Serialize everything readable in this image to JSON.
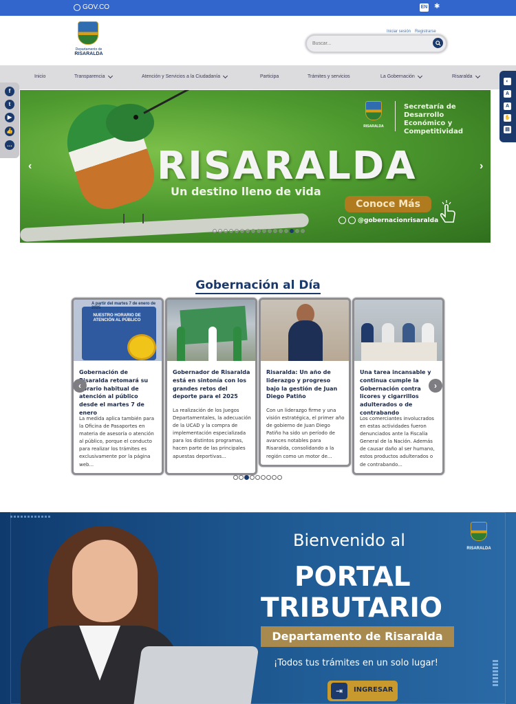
{
  "govbar": {
    "logo_text": "GOV.CO",
    "lang": "EN",
    "accessibility_icon": "accessibility-icon"
  },
  "header": {
    "logo_line1": "Departamento de",
    "logo_line2": "RISARALDA",
    "login": "Iniciar sesión",
    "register": "Registrarse",
    "search_placeholder": "Buscar..."
  },
  "nav": {
    "items": [
      {
        "label": "Inicio",
        "dropdown": false
      },
      {
        "label": "Transparencia",
        "dropdown": true
      },
      {
        "label": "Atención y Servicios a la Ciudadanía",
        "dropdown": true
      },
      {
        "label": "Participa",
        "dropdown": false
      },
      {
        "label": "Trámites y servicios",
        "dropdown": false
      },
      {
        "label": "La Gobernación",
        "dropdown": true
      },
      {
        "label": "Risaralda",
        "dropdown": true
      }
    ]
  },
  "social": [
    "facebook-icon",
    "twitter-icon",
    "youtube-icon",
    "like-icon",
    "chat-icon"
  ],
  "hero": {
    "title": "RISARALDA",
    "subtitle": "Un destino lleno de vida",
    "cta": "Conoce Más",
    "social_handle": "@gobernacionrisaralda",
    "secretaria": "Secretaría de Desarrollo Económico y Competitividad",
    "secretaria_logo": "RISARALDA",
    "slides_count": 17,
    "active_slide": 14
  },
  "section": {
    "title": "Gobernación al Día"
  },
  "news": [
    {
      "poster_top": "A partir del martes 7 de enero de 2025",
      "poster_main": "NUESTRO HORARIO DE ATENCIÓN AL PÚBLICO",
      "title": "Gobernación de Risaralda retomará su horario habitual de atención al público desde el martes 7 de enero",
      "body": "La medida aplica también para la Oficina de Pasaportes en materia de asesoría o atención al público, porque el conducto para realizar los trámites es exclusivamente por la página web..."
    },
    {
      "title": "Gobernador de Risaralda está en sintonía con los grandes retos del deporte para el 2025",
      "body": "La realización de los Juegos Departamentales, la adecuación de la UCAD y la compra de implementación especializada para los distintos programas, hacen parte de las principales apuestas deportivas..."
    },
    {
      "title": "Risaralda: Un año de liderazgo y progreso bajo la gestión de Juan Diego Patiño",
      "body": "Con un liderazgo firme y una visión estratégica, el primer año de gobierno de Juan Diego Patiño ha sido un período de avances notables para Risaralda, consolidando a la región como un motor de..."
    },
    {
      "title": "Una tarea incansable y continua cumple la Gobernación contra licores y cigarrillos adulterados o de contrabando",
      "body": "Los comerciantes involucrados en estas actividades fueron denunciados ante la Fiscalía General de la Nación. Además de causar daño al ser humano, estos productos adulterados o de contrabando..."
    }
  ],
  "carousel": {
    "dots_count": 9,
    "active_dot": 2
  },
  "banner": {
    "line1": "Bienvenido al",
    "line2": "PORTAL",
    "line3": "TRIBUTARIO",
    "dept": "Departamento de Risaralda",
    "tagline": "¡Todos tus trámites en un solo lugar!",
    "button": "INGRESAR",
    "logo_line1": "Departamento de",
    "logo_line2": "RISARALDA"
  }
}
